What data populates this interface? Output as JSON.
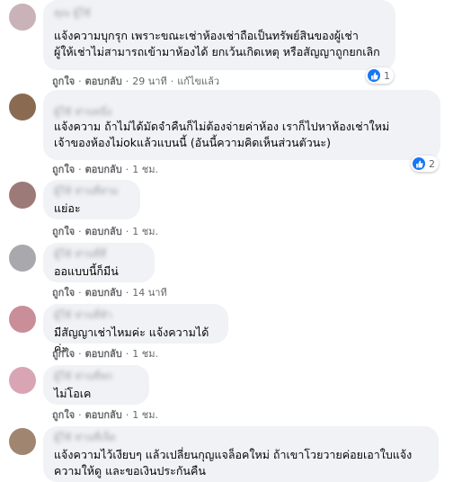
{
  "actions": {
    "like": "ถูกใจ",
    "reply": "ตอบกลับ",
    "edited": "แก้ไขแล้ว",
    "separator": "·"
  },
  "colors": {
    "bubble": "#f0f2f5",
    "like_blue": "#1877f2",
    "meta_gray": "#65676b"
  },
  "comments": [
    {
      "author": "คุณ ผู้ใช้",
      "text": "แจ้งความบุกรุก เพราะขณะเช่าห้องเช่าถือเป็นทรัพย์สินของผู้เช่า\nผู้ให้เช่าไม่สามารถเข้ามาห้องได้ ยกเว้นเกิดเหตุ หรือสัญญาถูกยกเลิก",
      "time": "29 นาที",
      "edited": true,
      "reaction_count": "1",
      "avatar_color": "#c9b3b8"
    },
    {
      "author": "ผู้ใช้ ท่านหนึ่ง",
      "text": "แจ้งความ ถ้าไม่ได้มัดจำคืนก็ไม่ต้องจ่ายค่าห้อง เราก็ไปหาห้องเช่าใหม่\nเจ้าของห้องไม่okแล้วแบนนี้ (อันนี้ความคิดเห็นส่วนตัวนะ)",
      "time": "1 ชม.",
      "edited": false,
      "reaction_count": "2",
      "avatar_color": "#8a6b52"
    },
    {
      "author": "ผู้ใช้ ท่านที่สาม",
      "text": "แย่อะ",
      "time": "1 ชม.",
      "edited": false,
      "reaction_count": "",
      "avatar_color": "#9c7a78"
    },
    {
      "author": "ผู้ใช้ ท่านที่สี่",
      "text": "ออแบบนี้ก็มีน่",
      "time": "14 นาที",
      "edited": false,
      "reaction_count": "",
      "avatar_color": "#a9a9ad"
    },
    {
      "author": "ผู้ใช้ ท่านที่ห้า",
      "text": "มีสัญญาเช่าไหมค่ะ แจ้งความได้ค่ะ",
      "time": "1 ชม.",
      "edited": false,
      "reaction_count": "",
      "avatar_color": "#c98e97"
    },
    {
      "author": "ผู้ใช้ ท่านที่หก",
      "text": "ไม่โอเค",
      "time": "1 ชม.",
      "edited": false,
      "reaction_count": "",
      "avatar_color": "#d9a5b4"
    },
    {
      "author": "ผู้ใช้ ท่านที่เจ็ด",
      "text": "แจ้งความไว้เงียบๆ แล้วเปลี่ยนกุญแจล็อคใหม่ ถ้าเขาโวยวายค่อยเอาใบแจ้ง\nความให้ดู และขอเงินประกันคืน",
      "time": "",
      "edited": false,
      "reaction_count": "",
      "avatar_color": "#a08570"
    }
  ]
}
